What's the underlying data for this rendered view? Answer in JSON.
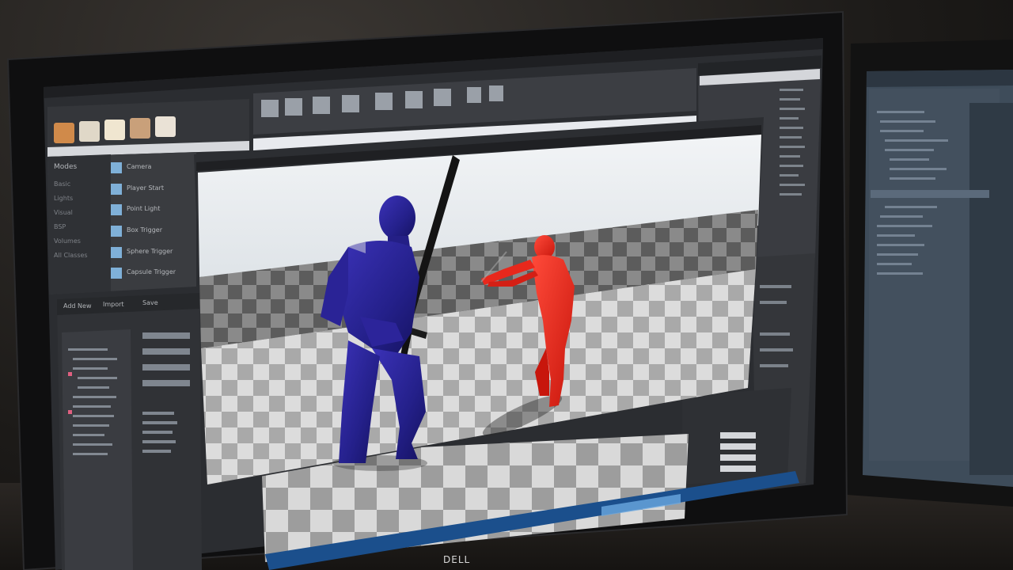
{
  "left_menu": {
    "title": "Modes",
    "items": [
      "Basic",
      "Lights",
      "Visual",
      "BSP",
      "Volumes",
      "All Classes"
    ]
  },
  "class_list": [
    "Camera",
    "Player Start",
    "Point Light",
    "Box Trigger",
    "Sphere Trigger",
    "Capsule Trigger"
  ],
  "content_browser": {
    "buttons": [
      "Add New",
      "Import",
      "Save"
    ]
  },
  "monitor_brand": "DELL",
  "colors": {
    "character_blue": "#2a1f8f",
    "character_red": "#e8281c",
    "editor_dark": "#2d2f33",
    "viewport_sky": "#e9edf0"
  },
  "icons": [
    "geometry-icon",
    "play-icon",
    "save-icon",
    "build-icon",
    "settings-icon"
  ]
}
